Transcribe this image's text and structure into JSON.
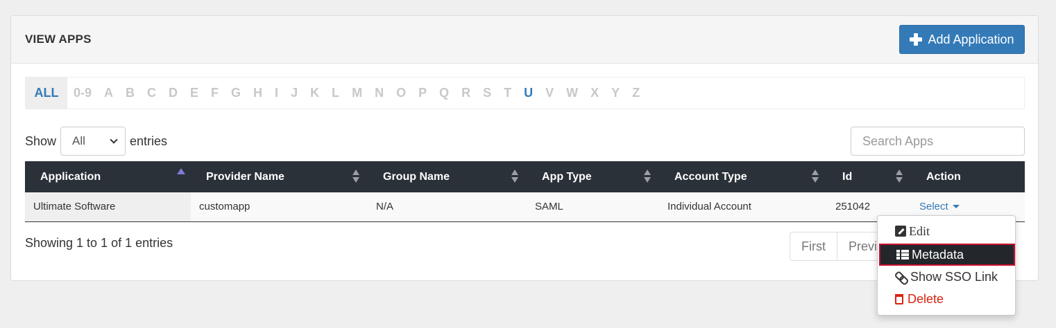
{
  "panel": {
    "title": "VIEW APPS",
    "add_button": "Add Application"
  },
  "alphabet": {
    "items": [
      "ALL",
      "0-9",
      "A",
      "B",
      "C",
      "D",
      "E",
      "F",
      "G",
      "H",
      "I",
      "J",
      "K",
      "L",
      "M",
      "N",
      "O",
      "P",
      "Q",
      "R",
      "S",
      "T",
      "U",
      "V",
      "W",
      "X",
      "Y",
      "Z"
    ],
    "selected": "ALL",
    "active": [
      "U"
    ]
  },
  "length": {
    "show_label": "Show",
    "selected": "All",
    "entries_label": "entries"
  },
  "search": {
    "placeholder": "Search Apps"
  },
  "table": {
    "columns": [
      "Application",
      "Provider Name",
      "Group Name",
      "App Type",
      "Account Type",
      "Id",
      "Action"
    ],
    "rows": [
      {
        "application": "Ultimate Software",
        "provider_name": "customapp",
        "group_name": "N/A",
        "app_type": "SAML",
        "account_type": "Individual Account",
        "id": "251042",
        "action": "Select"
      }
    ]
  },
  "info": "Showing 1 to 1 of 1 entries",
  "pager": {
    "first": "First",
    "previous": "Previous"
  },
  "dropdown": {
    "edit": "Edit",
    "metadata": "Metadata",
    "show_sso": "Show SSO Link",
    "delete": "Delete"
  },
  "colors": {
    "primary": "#337ab7",
    "header_dark": "#2b3138",
    "danger": "#d9230f",
    "highlight_border": "#c8102e"
  }
}
